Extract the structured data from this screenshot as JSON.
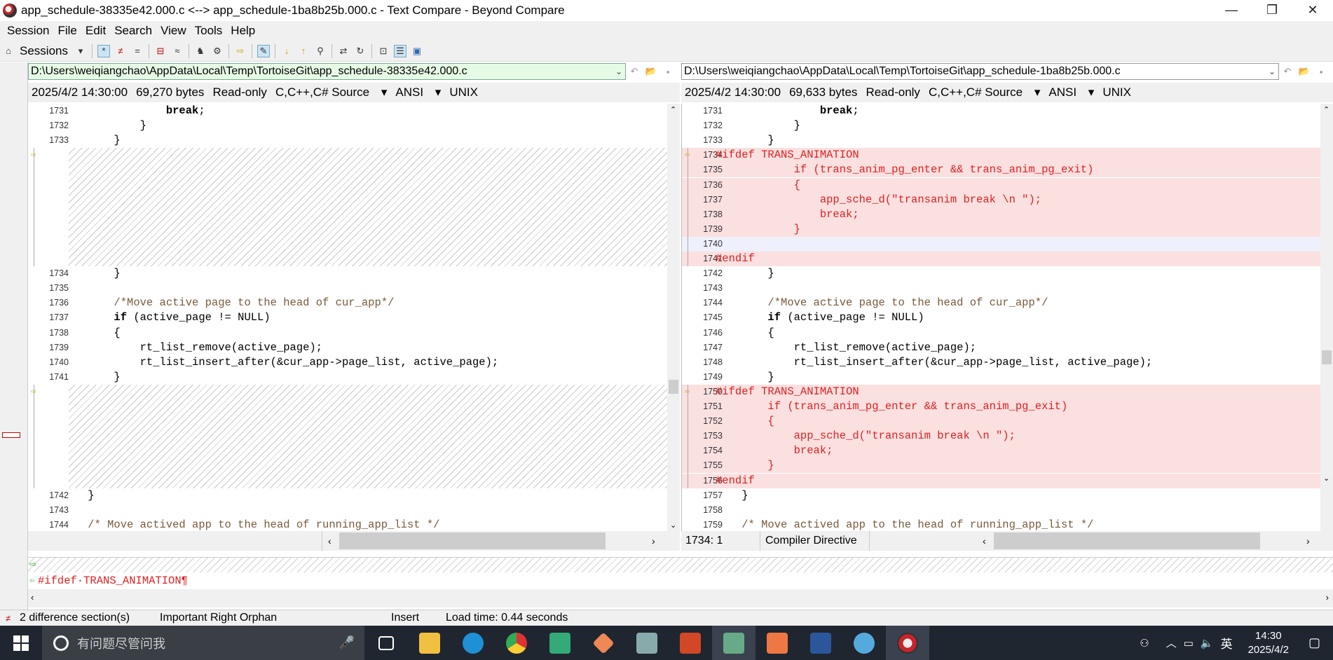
{
  "window": {
    "title": "app_schedule-38335e42.000.c <--> app_schedule-1ba8b25b.000.c - Text Compare - Beyond Compare",
    "minimize": "—",
    "restore": "❐",
    "close": "✕"
  },
  "menu": [
    "Session",
    "File",
    "Edit",
    "Search",
    "View",
    "Tools",
    "Help"
  ],
  "toolbar": {
    "sessions_label": "Sessions"
  },
  "left": {
    "path": "D:\\Users\\weiqiangchao\\AppData\\Local\\Temp\\TortoiseGit\\app_schedule-38335e42.000.c",
    "date": "2025/4/2 14:30:00",
    "size": "69,270 bytes",
    "mode": "Read-only",
    "format": "C,C++,C# Source",
    "encoding": "ANSI",
    "lineend": "UNIX",
    "lines": [
      {
        "n": "1731",
        "t": "                break;",
        "kw": "break"
      },
      {
        "n": "1732",
        "t": "            }"
      },
      {
        "n": "1733",
        "t": "        }"
      },
      {
        "n": "1734",
        "t": "        }"
      },
      {
        "n": "1735",
        "t": ""
      },
      {
        "n": "1736",
        "t": "        /*Move active page to the head of cur_app*/",
        "cm": true
      },
      {
        "n": "1737",
        "t": "        if (active_page != NULL)",
        "kw": "if"
      },
      {
        "n": "1738",
        "t": "        {"
      },
      {
        "n": "1739",
        "t": "            rt_list_remove(active_page);"
      },
      {
        "n": "1740",
        "t": "            rt_list_insert_after(&cur_app->page_list, active_page);"
      },
      {
        "n": "1741",
        "t": "        }"
      },
      {
        "n": "1742",
        "t": "    }"
      },
      {
        "n": "1743",
        "t": ""
      },
      {
        "n": "1744",
        "t": "    /* Move actived app to the head of running_app_list */",
        "cm": true
      }
    ]
  },
  "right": {
    "path": "D:\\Users\\weiqiangchao\\AppData\\Local\\Temp\\TortoiseGit\\app_schedule-1ba8b25b.000.c",
    "date": "2025/4/2 14:30:00",
    "size": "69,633 bytes",
    "mode": "Read-only",
    "format": "C,C++,C# Source",
    "encoding": "ANSI",
    "lineend": "UNIX",
    "cursor": "1734: 1",
    "context": "Compiler Directive",
    "lines": [
      {
        "n": "1731",
        "t": "                break;",
        "kw": "break"
      },
      {
        "n": "1732",
        "t": "            }"
      },
      {
        "n": "1733",
        "t": "        }"
      },
      {
        "n": "1734",
        "t": "#ifdef TRANS_ANIMATION",
        "red": true
      },
      {
        "n": "1735",
        "t": "            if (trans_anim_pg_enter && trans_anim_pg_exit)",
        "red": true
      },
      {
        "n": "1736",
        "t": "            {",
        "red": true
      },
      {
        "n": "1737",
        "t": "                app_sche_d(\"transanim break \\n \");",
        "red": true
      },
      {
        "n": "1738",
        "t": "                break;",
        "red": true
      },
      {
        "n": "1739",
        "t": "            }",
        "red": true
      },
      {
        "n": "1740",
        "t": "",
        "red": true
      },
      {
        "n": "1741",
        "t": "#endif",
        "red": true
      },
      {
        "n": "1742",
        "t": "        }"
      },
      {
        "n": "1743",
        "t": ""
      },
      {
        "n": "1744",
        "t": "        /*Move active page to the head of cur_app*/",
        "cm": true
      },
      {
        "n": "1745",
        "t": "        if (active_page != NULL)",
        "kw": "if"
      },
      {
        "n": "1746",
        "t": "        {"
      },
      {
        "n": "1747",
        "t": "            rt_list_remove(active_page);"
      },
      {
        "n": "1748",
        "t": "            rt_list_insert_after(&cur_app->page_list, active_page);"
      },
      {
        "n": "1749",
        "t": "        }"
      },
      {
        "n": "1750",
        "t": "#ifdef TRANS_ANIMATION",
        "red": true
      },
      {
        "n": "1751",
        "t": "        if (trans_anim_pg_enter && trans_anim_pg_exit)",
        "red": true
      },
      {
        "n": "1752",
        "t": "        {",
        "red": true
      },
      {
        "n": "1753",
        "t": "            app_sche_d(\"transanim break \\n \");",
        "red": true
      },
      {
        "n": "1754",
        "t": "            break;",
        "red": true
      },
      {
        "n": "1755",
        "t": "        }",
        "red": true
      },
      {
        "n": "1756",
        "t": "#endif",
        "red": true
      },
      {
        "n": "1757",
        "t": "    }"
      },
      {
        "n": "1758",
        "t": ""
      },
      {
        "n": "1759",
        "t": "    /* Move actived app to the head of running_app_list */",
        "cm": true
      }
    ]
  },
  "detail_line": "#ifdef·TRANS_ANIMATION¶",
  "status": {
    "diffs": "2 difference section(s)",
    "orphan": "Important Right Orphan",
    "insert": "Insert",
    "load": "Load time: 0.44 seconds"
  },
  "taskbar": {
    "search_placeholder": "有问题尽管问我",
    "time": "14:30",
    "date": "2025/4/2",
    "ime": "英"
  },
  "colors": {
    "diff_bg": "#fbe0e0",
    "diff_text": "#e02020",
    "accent": "#c9a100"
  }
}
